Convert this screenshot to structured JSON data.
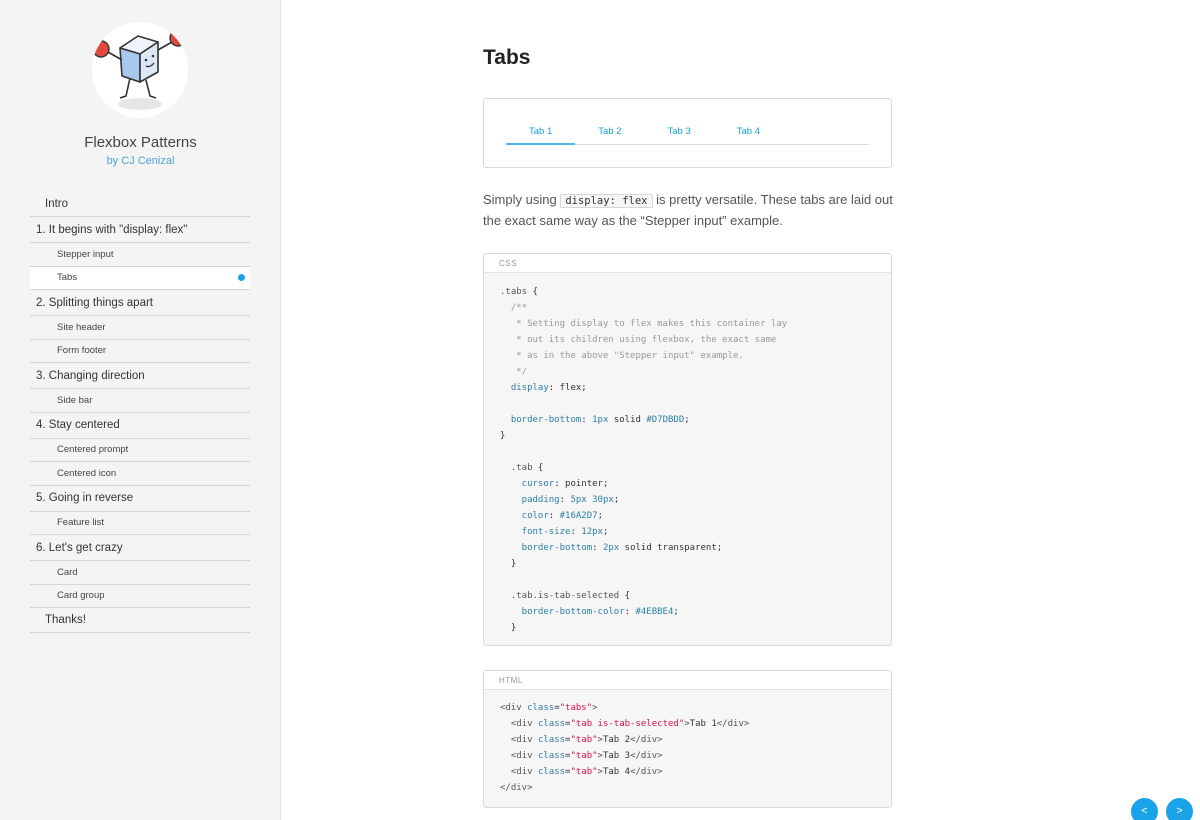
{
  "brand": {
    "title": "Flexbox Patterns",
    "author": "by CJ Cenizal"
  },
  "nav": [
    {
      "label": "Intro",
      "level": 0
    },
    {
      "label": "1. It begins with \"display: flex\"",
      "level": 1
    },
    {
      "label": "Stepper input",
      "level": 2
    },
    {
      "label": "Tabs",
      "level": 2,
      "active": true
    },
    {
      "label": "2. Splitting things apart",
      "level": 1
    },
    {
      "label": "Site header",
      "level": 2
    },
    {
      "label": "Form footer",
      "level": 2
    },
    {
      "label": "3. Changing direction",
      "level": 1
    },
    {
      "label": "Side bar",
      "level": 2
    },
    {
      "label": "4. Stay centered",
      "level": 1
    },
    {
      "label": "Centered prompt",
      "level": 2
    },
    {
      "label": "Centered icon",
      "level": 2
    },
    {
      "label": "5. Going in reverse",
      "level": 1
    },
    {
      "label": "Feature list",
      "level": 2
    },
    {
      "label": "6. Let's get crazy",
      "level": 1
    },
    {
      "label": "Card",
      "level": 2
    },
    {
      "label": "Card group",
      "level": 2
    },
    {
      "label": "Thanks!",
      "level": 0
    }
  ],
  "page": {
    "title": "Tabs"
  },
  "demo_tabs": [
    {
      "label": "Tab 1",
      "selected": true
    },
    {
      "label": "Tab 2"
    },
    {
      "label": "Tab 3"
    },
    {
      "label": "Tab 4"
    }
  ],
  "description": {
    "before": "Simply using ",
    "code": "display: flex",
    "after": " is pretty versatile. These tabs are laid out the exact same way as the “Stepper input” example."
  },
  "css_block": {
    "label": "CSS",
    "lines": [
      [
        [
          ".tabs",
          "sel"
        ],
        [
          " {",
          ""
        ]
      ],
      [
        [
          "  /**",
          "com"
        ]
      ],
      [
        [
          "   * Setting display to flex makes this container lay",
          "com"
        ]
      ],
      [
        [
          "   * out its children using flexbox, the exact same",
          "com"
        ]
      ],
      [
        [
          "   * as in the above \"Stepper input\" example.",
          "com"
        ]
      ],
      [
        [
          "   */",
          "com"
        ]
      ],
      [
        [
          "  display",
          "prop"
        ],
        [
          ": flex;",
          ""
        ]
      ],
      [
        [
          "",
          ""
        ]
      ],
      [
        [
          "  border-bottom",
          "prop"
        ],
        [
          ": ",
          ""
        ],
        [
          "1px",
          "num"
        ],
        [
          " solid ",
          ""
        ],
        [
          "#D7DBDD",
          "num"
        ],
        [
          ";",
          ""
        ]
      ],
      [
        [
          "}",
          ""
        ]
      ],
      [
        [
          "",
          ""
        ]
      ],
      [
        [
          "  .tab",
          "sel"
        ],
        [
          " {",
          ""
        ]
      ],
      [
        [
          "    cursor",
          "prop"
        ],
        [
          ": pointer;",
          ""
        ]
      ],
      [
        [
          "    padding",
          "prop"
        ],
        [
          ": ",
          ""
        ],
        [
          "5px 30px",
          "num"
        ],
        [
          ";",
          ""
        ]
      ],
      [
        [
          "    color",
          "prop"
        ],
        [
          ": ",
          ""
        ],
        [
          "#16A2D7",
          "num"
        ],
        [
          ";",
          ""
        ]
      ],
      [
        [
          "    font-size",
          "prop"
        ],
        [
          ": ",
          ""
        ],
        [
          "12px",
          "num"
        ],
        [
          ";",
          ""
        ]
      ],
      [
        [
          "    border-bottom",
          "prop"
        ],
        [
          ": ",
          ""
        ],
        [
          "2px",
          "num"
        ],
        [
          " solid transparent;",
          ""
        ]
      ],
      [
        [
          "  }",
          ""
        ]
      ],
      [
        [
          "",
          ""
        ]
      ],
      [
        [
          "  .tab.is-tab-selected",
          "sel"
        ],
        [
          " {",
          ""
        ]
      ],
      [
        [
          "    border-bottom-color",
          "prop"
        ],
        [
          ": ",
          ""
        ],
        [
          "#4EBBE4",
          "num"
        ],
        [
          ";",
          ""
        ]
      ],
      [
        [
          "  }",
          ""
        ]
      ]
    ]
  },
  "html_block": {
    "label": "HTML",
    "lines": [
      [
        [
          "<div ",
          "tag"
        ],
        [
          "class",
          "attr"
        ],
        [
          "=",
          ""
        ],
        [
          "\"tabs\"",
          "str"
        ],
        [
          ">",
          "tag"
        ]
      ],
      [
        [
          "  <div ",
          "tag"
        ],
        [
          "class",
          "attr"
        ],
        [
          "=",
          ""
        ],
        [
          "\"tab is-tab-selected\"",
          "str"
        ],
        [
          ">",
          "tag"
        ],
        [
          "Tab 1",
          ""
        ],
        [
          "</div>",
          "tag"
        ]
      ],
      [
        [
          "  <div ",
          "tag"
        ],
        [
          "class",
          "attr"
        ],
        [
          "=",
          ""
        ],
        [
          "\"tab\"",
          "str"
        ],
        [
          ">",
          "tag"
        ],
        [
          "Tab 2",
          ""
        ],
        [
          "</div>",
          "tag"
        ]
      ],
      [
        [
          "  <div ",
          "tag"
        ],
        [
          "class",
          "attr"
        ],
        [
          "=",
          ""
        ],
        [
          "\"tab\"",
          "str"
        ],
        [
          ">",
          "tag"
        ],
        [
          "Tab 3",
          ""
        ],
        [
          "</div>",
          "tag"
        ]
      ],
      [
        [
          "  <div ",
          "tag"
        ],
        [
          "class",
          "attr"
        ],
        [
          "=",
          ""
        ],
        [
          "\"tab\"",
          "str"
        ],
        [
          ">",
          "tag"
        ],
        [
          "Tab 4",
          ""
        ],
        [
          "</div>",
          "tag"
        ]
      ],
      [
        [
          "</div>",
          "tag"
        ]
      ]
    ]
  },
  "pager": {
    "prev": "<",
    "next": ">"
  },
  "colors": {
    "accent": "#1aa3e8",
    "tab_text": "#16a2d7",
    "tab_selected": "#4ebbe4",
    "border": "#d7dbdd"
  }
}
